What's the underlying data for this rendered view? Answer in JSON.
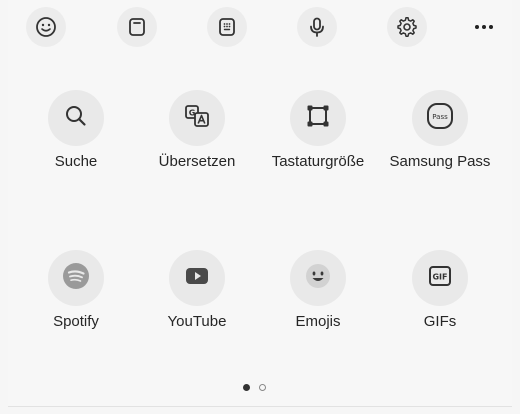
{
  "toolbar": {
    "icons": [
      "smiley-icon",
      "clipboard-icon",
      "keypad-icon",
      "microphone-icon",
      "gear-icon",
      "more-icon"
    ]
  },
  "tiles": [
    {
      "label": "Suche",
      "icon": "search-icon"
    },
    {
      "label": "Übersetzen",
      "icon": "translate-icon"
    },
    {
      "label": "Tastaturgröße",
      "icon": "keyboard-size-icon"
    },
    {
      "label": "Samsung Pass",
      "icon": "samsung-pass-icon"
    },
    {
      "label": "Spotify",
      "icon": "spotify-icon"
    },
    {
      "label": "YouTube",
      "icon": "youtube-icon"
    },
    {
      "label": "Emojis",
      "icon": "emoji-icon"
    },
    {
      "label": "GIFs",
      "icon": "gif-icon"
    }
  ],
  "pager": {
    "current_page": 1,
    "total_pages": 2
  },
  "colors": {
    "background": "#f7f7f7",
    "button": "#ececec",
    "icon": "#333333"
  }
}
